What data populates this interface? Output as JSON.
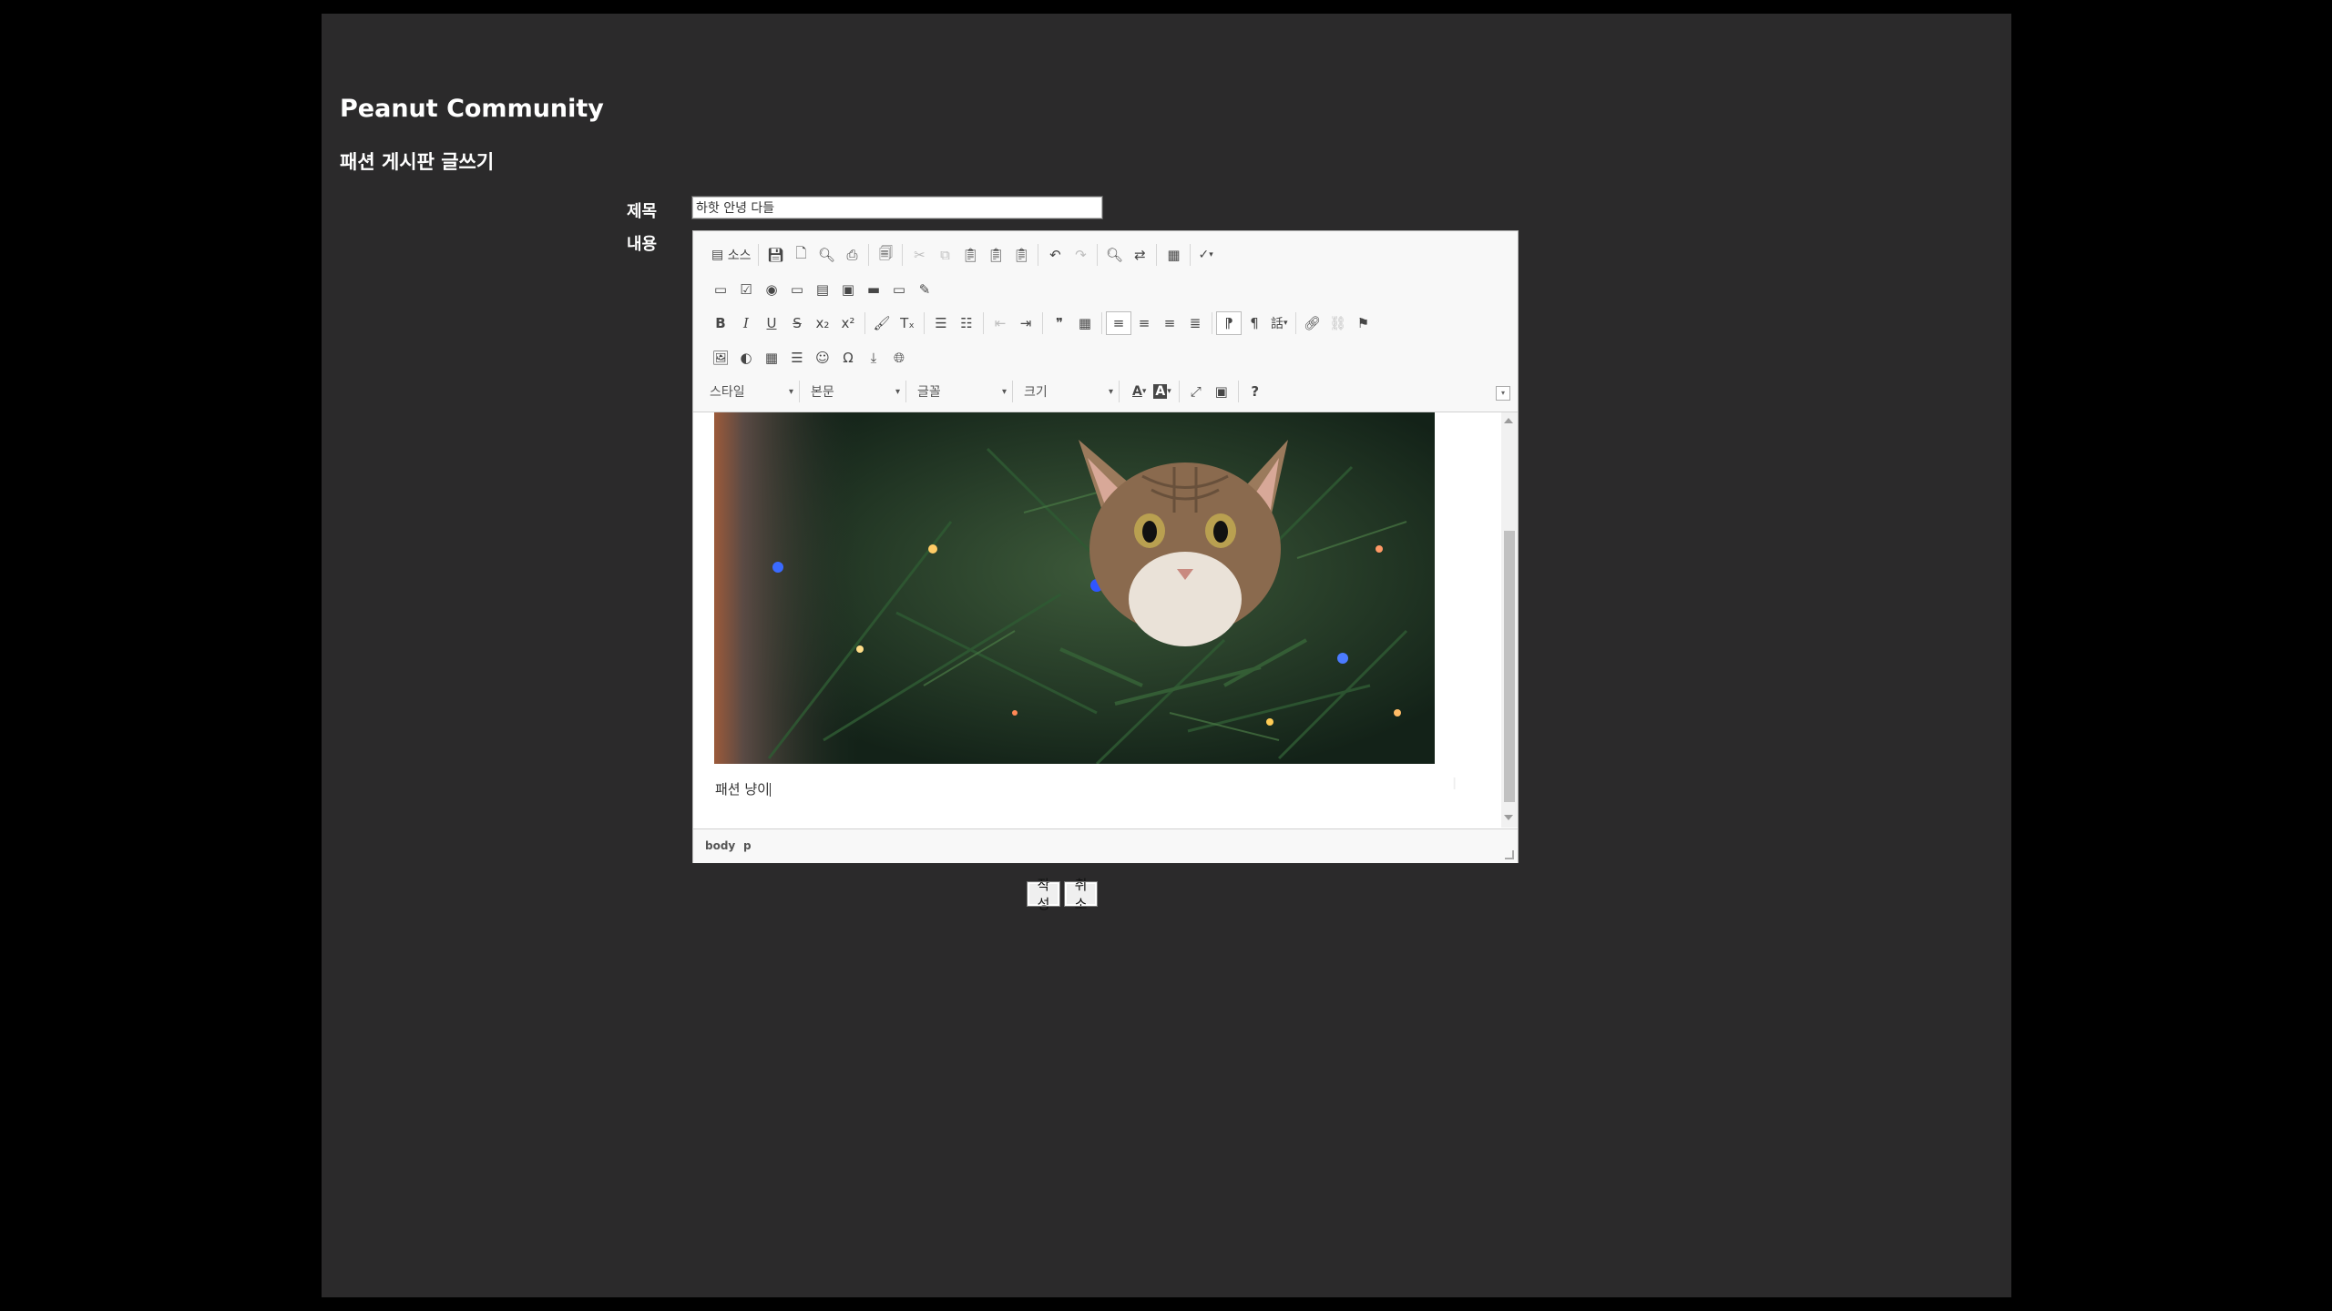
{
  "site": {
    "title": "Peanut Community"
  },
  "board": {
    "title": "패션 게시판 글쓰기"
  },
  "form": {
    "title_label": "제목",
    "title_value": "하핫 안녕 다들",
    "content_label": "내용",
    "submit_label": "작성",
    "cancel_label": "취소"
  },
  "editor": {
    "toolbar": {
      "source_label": "소스",
      "styles_combo": "스타일",
      "format_combo": "본문",
      "font_combo": "글꼴",
      "size_combo": "크기",
      "help_label": "?"
    },
    "body_text": "패션 냥이",
    "elements_path": [
      "body",
      "p"
    ]
  },
  "colors": {
    "page_bg": "#2b2a2b",
    "outer_bg": "#000000",
    "toolbar_bg": "#f8f8f8"
  }
}
